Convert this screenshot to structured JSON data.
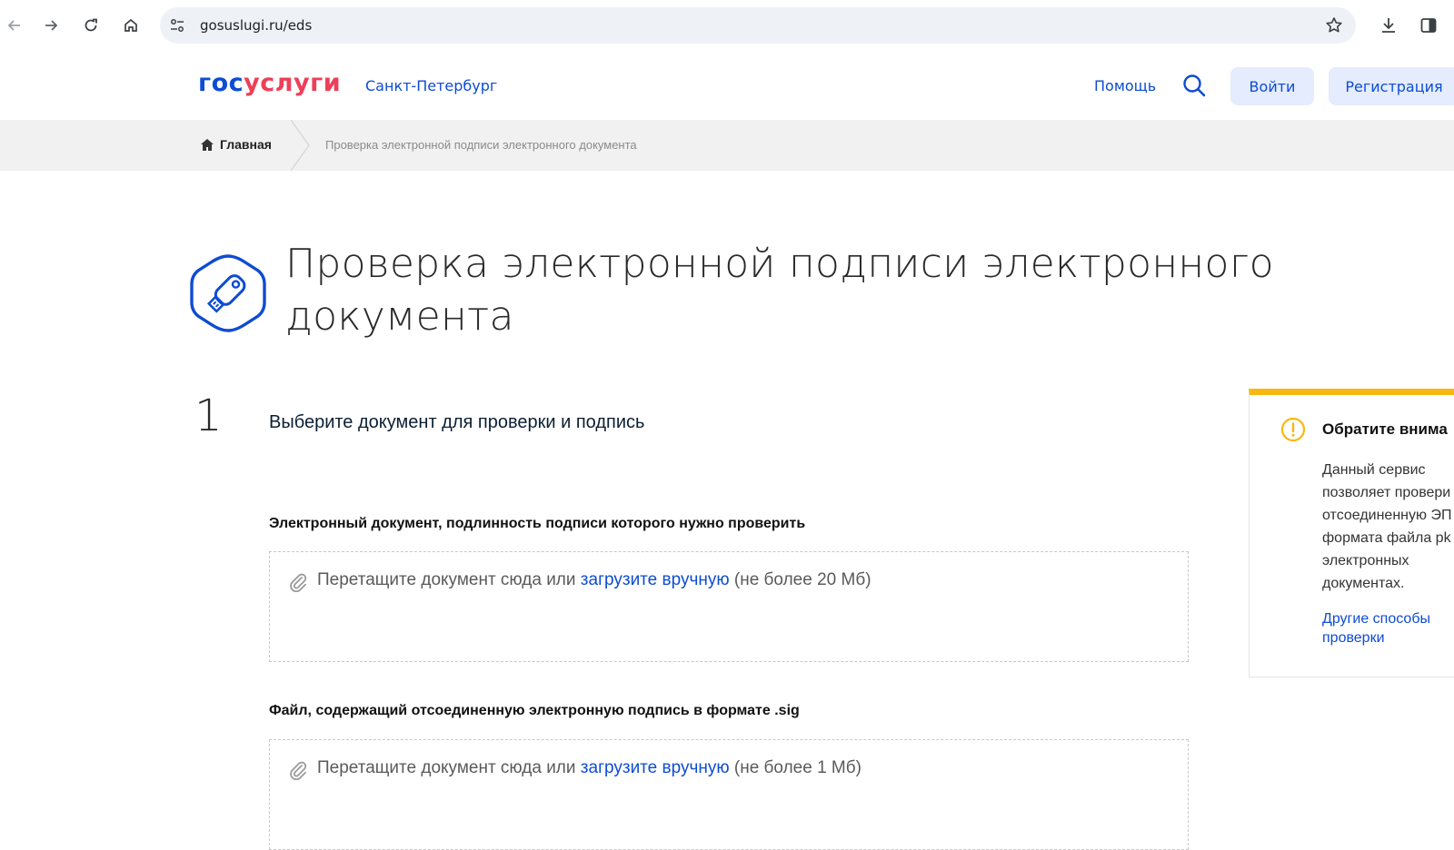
{
  "browser": {
    "url": "gosuslugi.ru/eds"
  },
  "header": {
    "logo_part1": "гос",
    "logo_part2": "услуги",
    "region": "Санкт-Петербург",
    "help": "Помощь",
    "login": "Войти",
    "register": "Регистрация"
  },
  "breadcrumb": {
    "home": "Главная",
    "current": "Проверка электронной подписи электронного документа"
  },
  "page": {
    "title": "Проверка электронной подписи электронного документа"
  },
  "step": {
    "number": "1",
    "title": "Выберите документ для проверки и подпись"
  },
  "fields": [
    {
      "label": "Электронный документ, подлинность подписи которого нужно проверить",
      "drop_prefix": "Перетащите документ сюда или ",
      "drop_link": "загрузите вручную",
      "drop_suffix": " (не более 20 Мб)"
    },
    {
      "label": "Файл, содержащий отсоединенную электронную подпись в формате .sig",
      "drop_prefix": "Перетащите документ сюда или ",
      "drop_link": "загрузите вручную",
      "drop_suffix": " (не более 1 Мб)"
    }
  ],
  "notice": {
    "title": "Обратите внима",
    "body": "Данный сервис\nпозволяет провери\nотсоединенную ЭП\nформата файла pk\nэлектронных\nдокументах.",
    "link": "Другие способы\nпроверки"
  },
  "colors": {
    "brand_blue": "#0d4cd3",
    "brand_red": "#ee3f58",
    "notice_accent": "#f8b80f"
  }
}
